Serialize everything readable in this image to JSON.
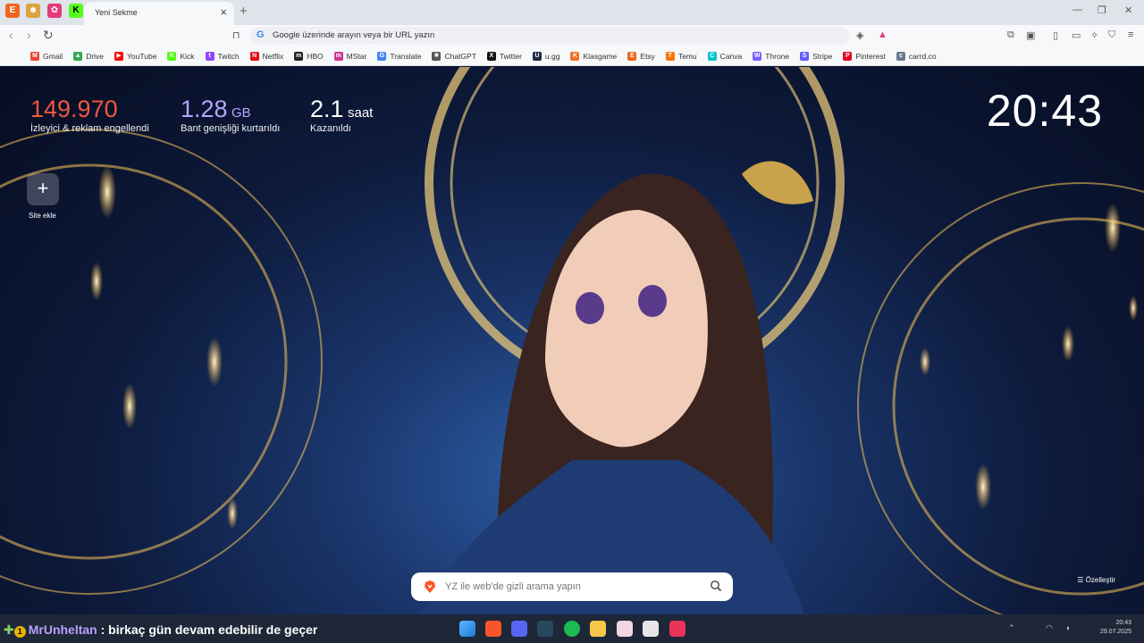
{
  "tabs": {
    "active_title": "Yeni Sekme",
    "new_tab": "+"
  },
  "window": {
    "minimize": "—",
    "restore": "❐",
    "close": "✕"
  },
  "toolbar": {
    "url_placeholder": "Google üzerinde arayın veya bir URL yazın"
  },
  "bookmarks": [
    {
      "label": "Gmail",
      "color": "#ea4335",
      "glyph": "M"
    },
    {
      "label": "Drive",
      "color": "#34a853",
      "glyph": "▲"
    },
    {
      "label": "YouTube",
      "color": "#ff0000",
      "glyph": "▶"
    },
    {
      "label": "Kick",
      "color": "#53fc18",
      "glyph": "K"
    },
    {
      "label": "Twitch",
      "color": "#9146ff",
      "glyph": "t"
    },
    {
      "label": "Netflix",
      "color": "#e50914",
      "glyph": "N"
    },
    {
      "label": "HBO",
      "color": "#222222",
      "glyph": "m"
    },
    {
      "label": "MStar",
      "color": "#d0338f",
      "glyph": "m"
    },
    {
      "label": "Translate",
      "color": "#4285f4",
      "glyph": "G"
    },
    {
      "label": "ChatGPT",
      "color": "#555555",
      "glyph": "✺"
    },
    {
      "label": "Twitter",
      "color": "#111111",
      "glyph": "X"
    },
    {
      "label": "u.gg",
      "color": "#1f2a44",
      "glyph": "U"
    },
    {
      "label": "Klasgame",
      "color": "#f07020",
      "glyph": "K"
    },
    {
      "label": "Etsy",
      "color": "#f1641e",
      "glyph": "E"
    },
    {
      "label": "Temu",
      "color": "#fb7701",
      "glyph": "T"
    },
    {
      "label": "Canva",
      "color": "#00c4cc",
      "glyph": "C"
    },
    {
      "label": "Throne",
      "color": "#7b5cff",
      "glyph": "W"
    },
    {
      "label": "Stripe",
      "color": "#635bff",
      "glyph": "S"
    },
    {
      "label": "Pinterest",
      "color": "#e60023",
      "glyph": "P"
    },
    {
      "label": "carrd.co",
      "color": "#6a7a8c",
      "glyph": "c"
    }
  ],
  "stats": [
    {
      "value": "149.970",
      "unit": "",
      "label": "İzleyici & reklam engellendi",
      "color": "#f2563f"
    },
    {
      "value": "1.28",
      "unit": "GB",
      "label": "Bant genişliği kurtarıldı",
      "color": "#b7a4ff"
    },
    {
      "value": "2.1",
      "unit": "saat",
      "label": "Kazanıldı",
      "color": "#ffffff"
    }
  ],
  "clock": "20:43",
  "add_site": {
    "symbol": "+",
    "label": "Site ekle"
  },
  "search": {
    "placeholder": "YZ ile web'de gizli arama yapın"
  },
  "customize": "Özelleştir",
  "chat": {
    "badge": "1",
    "user": "MrUnheltan",
    "message": " : birkaç gün devam edebilir de geçer"
  },
  "tray": {
    "time": "20:43",
    "date": "29.07.2025"
  }
}
